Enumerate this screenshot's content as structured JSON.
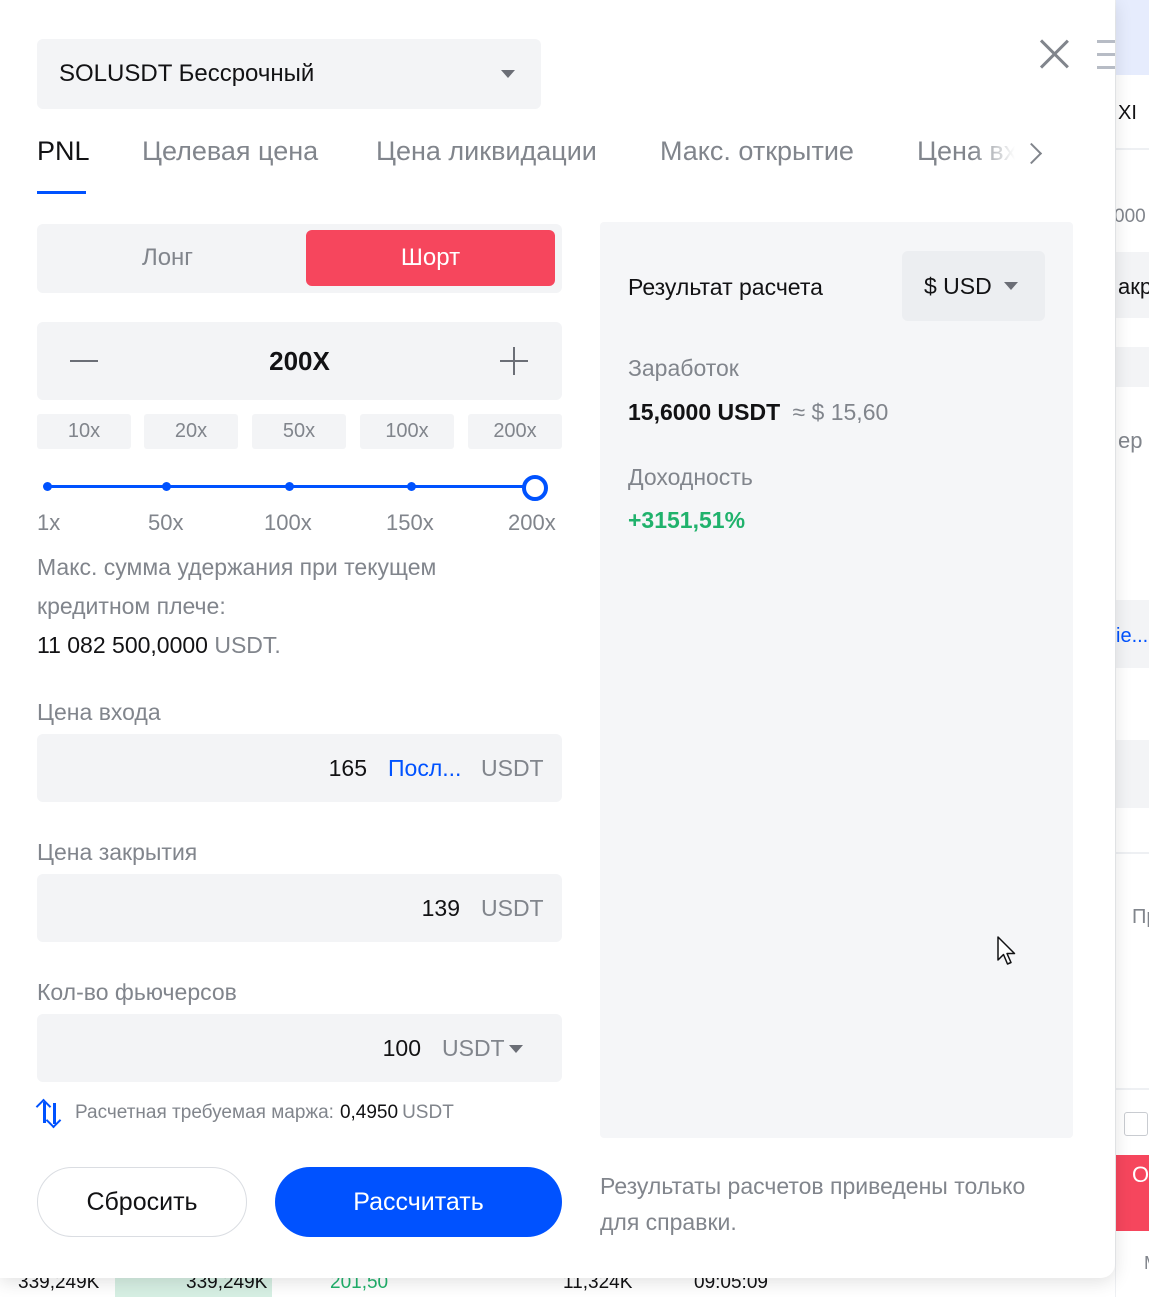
{
  "modal": {
    "symbol": "SOLUSDT Бессрочный",
    "tabs": [
      "PNL",
      "Целевая цена",
      "Цена ликвидации",
      "Макс. открытие",
      "Цена вх"
    ],
    "side": {
      "long_label": "Лонг",
      "short_label": "Шорт",
      "selected": "Шорт"
    },
    "leverage": {
      "value": "200X",
      "presets": [
        "10x",
        "20x",
        "50x",
        "100x",
        "200x"
      ],
      "slider_labels": [
        "1x",
        "50x",
        "100x",
        "150x",
        "200x"
      ],
      "slider_fraction": 1.0
    },
    "max_hold": {
      "text": "Макс. сумма удержания при текущем кредитном плече:",
      "value": "11 082 500,0000",
      "unit": "USDT."
    },
    "entry_price": {
      "label": "Цена входа",
      "value": "165",
      "last_link": "Посл...",
      "unit": "USDT"
    },
    "close_price": {
      "label": "Цена закрытия",
      "value": "139",
      "unit": "USDT"
    },
    "quantity": {
      "label": "Кол-во фьючерсов",
      "value": "100",
      "unit": "USDT"
    },
    "margin": {
      "label": "Расчетная требуемая маржа:",
      "value": "0,4950",
      "unit": "USDT"
    },
    "buttons": {
      "reset": "Сбросить",
      "calculate": "Рассчитать"
    },
    "result": {
      "title": "Результат расчета",
      "currency": "$ USD",
      "earnings_label": "Заработок",
      "earnings_value": "15,6000 USDT",
      "earnings_approx": "≈ $ 15,60",
      "yield_label": "Доходность",
      "yield_value": "+3151,51%"
    },
    "disclaimer": "Результаты расчетов приведены только для справки."
  },
  "background": {
    "right_texts": [
      "XI",
      "000",
      "акр",
      "ер",
      "Пр",
      "О",
      "М"
    ],
    "right_link": "ie...",
    "bottom_texts": [
      "339,249K",
      "339,249K",
      "201,50",
      "11,324K",
      "09:05:09"
    ]
  },
  "colors": {
    "accent": "#0052ff",
    "short_red": "#f6465d",
    "profit_green": "#20b26c"
  }
}
